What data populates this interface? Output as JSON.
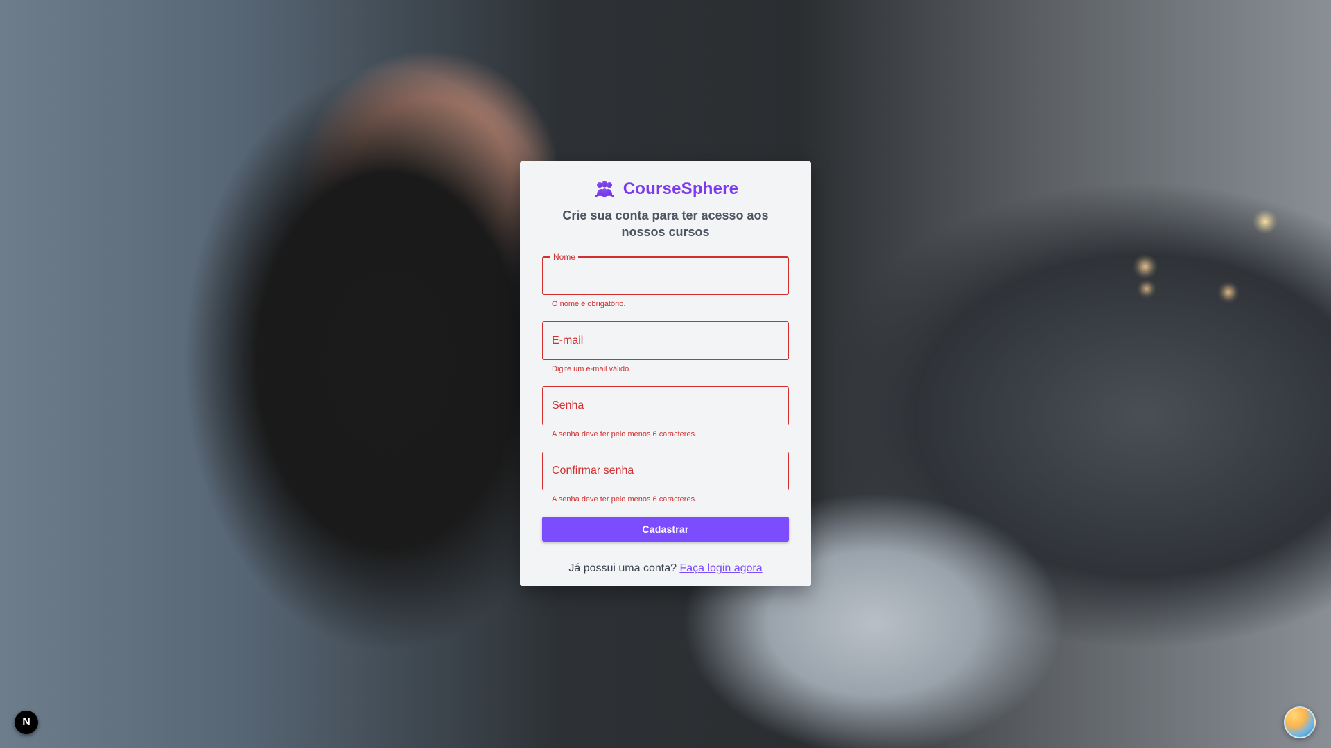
{
  "brand": {
    "title": "CourseSphere",
    "icon": "people-icon",
    "color": "#7c3aed"
  },
  "card": {
    "subtitle": "Crie sua conta para ter acesso aos nossos cursos"
  },
  "form": {
    "fields": [
      {
        "id": "name",
        "label": "Nome",
        "value": "",
        "placeholder": "",
        "helper": "O nome é obrigatório.",
        "state": "error",
        "focused": true
      },
      {
        "id": "email",
        "label": "",
        "value": "",
        "placeholder": "E-mail",
        "helper": "Digite um e-mail válido.",
        "state": "error",
        "focused": false
      },
      {
        "id": "password",
        "label": "",
        "value": "",
        "placeholder": "Senha",
        "helper": "A senha deve ter pelo menos 6 caracteres.",
        "state": "error",
        "focused": false
      },
      {
        "id": "confirm_password",
        "label": "",
        "value": "",
        "placeholder": "Confirmar senha",
        "helper": "A senha deve ter pelo menos 6 caracteres.",
        "state": "error",
        "focused": false
      }
    ],
    "submit_label": "Cadastrar"
  },
  "login": {
    "text": "Já possui uma conta?",
    "link": "Faça login agora"
  },
  "colors": {
    "error": "#d32f2f",
    "primary": "#7c4dff",
    "card_bg": "#f3f4f6"
  },
  "corner": {
    "left_badge": "N",
    "left_icon": "next-logo-icon",
    "right_icon": "avatar-icon"
  }
}
